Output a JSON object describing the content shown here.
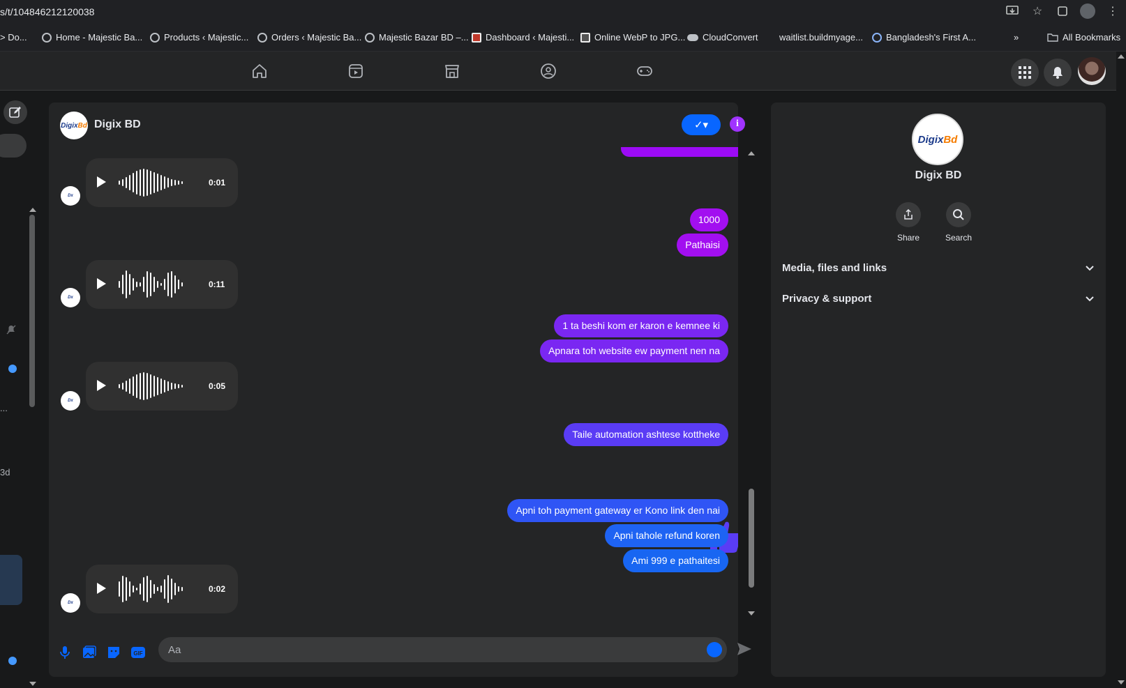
{
  "browser": {
    "url": "s/t/104846212120038",
    "bookmarks": [
      {
        "label": "> Do..."
      },
      {
        "label": "Home - Majestic Ba..."
      },
      {
        "label": "Products ‹ Majestic..."
      },
      {
        "label": "Orders ‹ Majestic Ba..."
      },
      {
        "label": "Majestic Bazar BD –..."
      },
      {
        "label": "Dashboard ‹ Majesti..."
      },
      {
        "label": "Online WebP to JPG..."
      },
      {
        "label": "CloudConvert"
      },
      {
        "label": "waitlist.buildmyage..."
      },
      {
        "label": "Bangladesh's First A..."
      }
    ],
    "more_bookmarks": "»",
    "all_bookmarks": "All Bookmarks"
  },
  "left": {
    "small_1": "...",
    "small_2": "3d"
  },
  "chat": {
    "title": "Digix BD",
    "logo_text": "Digix",
    "logo_accent": "Bd",
    "check_label": "✓▾",
    "info_label": "i",
    "voice_messages": [
      {
        "duration": "0:01"
      },
      {
        "duration": "0:11"
      },
      {
        "duration": "0:05"
      },
      {
        "duration": "0:02"
      }
    ],
    "outgoing": [
      {
        "text": "1000",
        "color": "#a20ff0"
      },
      {
        "text": "Pathaisi",
        "color": "#a20ff0"
      },
      {
        "text": "1 ta beshi kom er karon e kemnee ki",
        "color": "#7a27f2"
      },
      {
        "text": "Apnara toh website ew payment nen na",
        "color": "#7a27f2"
      },
      {
        "text": "Taile automation ashtese kottheke",
        "color": "#5a3cf5"
      },
      {
        "text": "Apni toh payment gateway er Kono link den nai",
        "color": "#2f55f5"
      },
      {
        "text": "Apni tahole refund koren",
        "color": "#1e63f3"
      },
      {
        "text": "Ami 999 e pathaitesi",
        "color": "#1866f2"
      }
    ],
    "composer_placeholder": "Aa"
  },
  "info_panel": {
    "name": "Digix BD",
    "actions": [
      {
        "label": "Share"
      },
      {
        "label": "Search"
      }
    ],
    "sections": [
      {
        "label": "Media, files and links"
      },
      {
        "label": "Privacy & support"
      }
    ]
  },
  "colors": {
    "accent_blue": "#0866ff",
    "accent_purple": "#a033ff"
  }
}
